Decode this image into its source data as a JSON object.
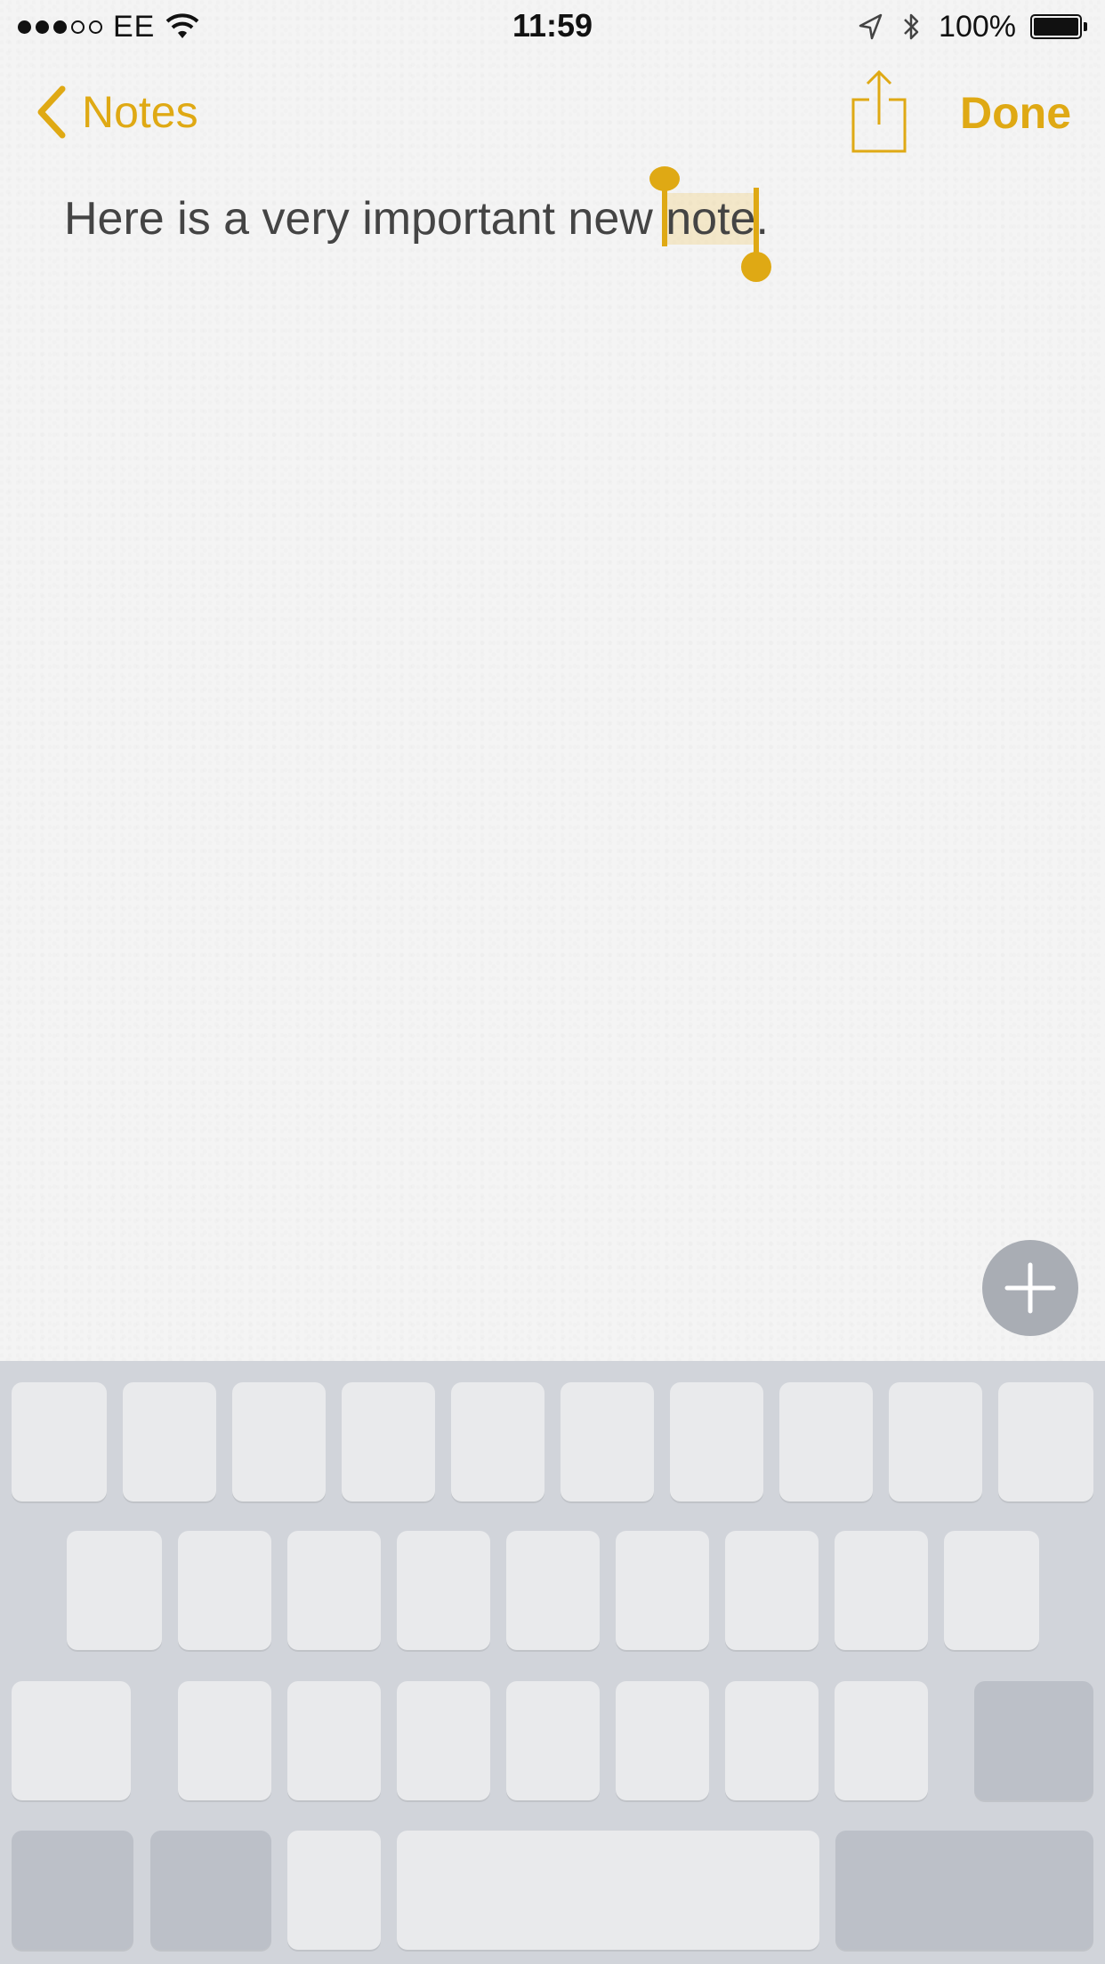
{
  "status_bar": {
    "carrier": "EE",
    "time": "11:59",
    "battery": "100%",
    "icons": [
      "signal-dots",
      "wifi-icon",
      "location-icon",
      "bluetooth-icon",
      "battery-icon"
    ]
  },
  "nav": {
    "back_label": "Notes",
    "done_label": "Done",
    "share_icon": "share-icon",
    "accent_color": "#dfa914"
  },
  "note": {
    "text_before": "Here is a very important new ",
    "selected_text": "note",
    "text_after": ".",
    "selection_color": "#f0cd78"
  },
  "add_button": {
    "icon": "plus-icon"
  },
  "keyboard": {
    "state": "keys without labels",
    "background": "#d1d4da"
  }
}
